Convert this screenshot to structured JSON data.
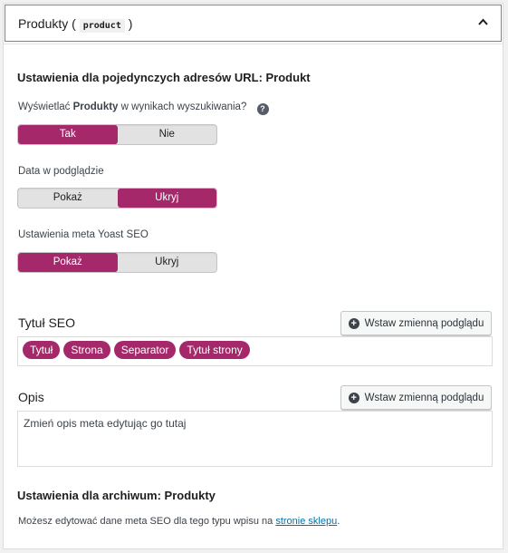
{
  "header": {
    "title": "Produkty (",
    "code": "product",
    "title_end": ")"
  },
  "single": {
    "section_title": "Ustawienia dla pojedynczych adresów URL: Produkt",
    "search_label_prefix": "Wyświetlać ",
    "search_label_bold": "Produkty",
    "search_label_suffix": " w wynikach wyszukiwania?",
    "help_icon": "?",
    "search_toggle": {
      "options": [
        "Tak",
        "Nie"
      ],
      "selected": "Tak"
    },
    "date_label": "Data w podglądzie",
    "date_toggle": {
      "options": [
        "Pokaż",
        "Ukryj"
      ],
      "selected": "Ukryj"
    },
    "meta_label": "Ustawienia meta Yoast SEO",
    "meta_toggle": {
      "options": [
        "Pokaż",
        "Ukryj"
      ],
      "selected": "Pokaż"
    }
  },
  "seo_title": {
    "label": "Tytuł SEO",
    "insert_button": "Wstaw zmienną podglądu",
    "tags": [
      "Tytuł",
      "Strona",
      "Separator",
      "Tytuł strony"
    ]
  },
  "description": {
    "label": "Opis",
    "insert_button": "Wstaw zmienną podglądu",
    "placeholder_text": "Zmień opis meta edytując go tutaj"
  },
  "archive": {
    "section_title": "Ustawienia dla archiwum: Produkty",
    "text_prefix": "Możesz edytować dane meta SEO dla tego typu wpisu na ",
    "link_text": "stronie sklepu",
    "text_suffix": "."
  },
  "colors": {
    "accent": "#a4286a",
    "link": "#0073aa",
    "focus_border": "#4b8ed6"
  }
}
